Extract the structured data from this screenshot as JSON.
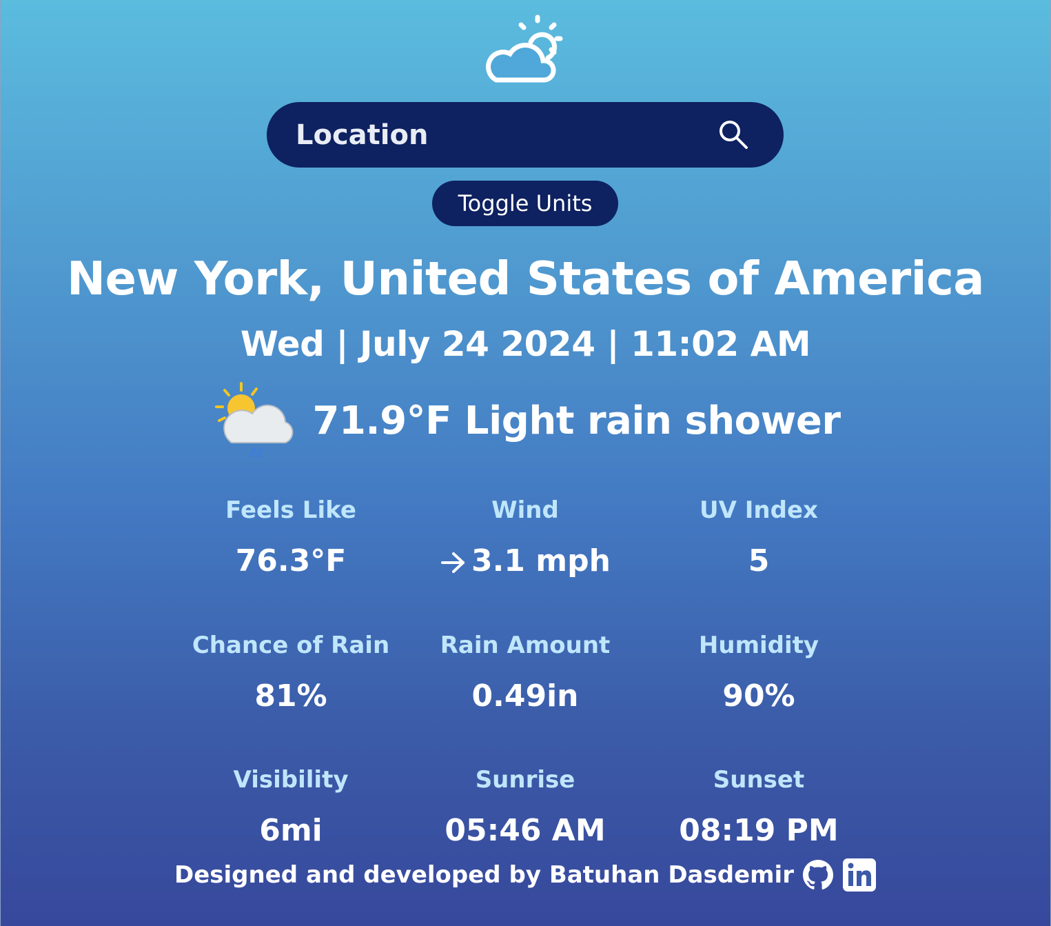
{
  "search": {
    "placeholder": "Location"
  },
  "toggle_label": "Toggle Units",
  "location": "New York, United States of America",
  "datetime": "Wed | July 24 2024 | 11:02 AM",
  "current": {
    "summary": "71.9°F Light rain shower",
    "icon": "sun-cloud-rain-icon"
  },
  "stats": {
    "feels_like": {
      "label": "Feels Like",
      "value": "76.3°F"
    },
    "wind": {
      "label": "Wind",
      "value": "3.1 mph"
    },
    "uv_index": {
      "label": "UV Index",
      "value": "5"
    },
    "chance_of_rain": {
      "label": "Chance of Rain",
      "value": "81%"
    },
    "rain_amount": {
      "label": "Rain Amount",
      "value": "0.49in"
    },
    "humidity": {
      "label": "Humidity",
      "value": "90%"
    },
    "visibility": {
      "label": "Visibility",
      "value": "6mi"
    },
    "sunrise": {
      "label": "Sunrise",
      "value": "05:46 AM"
    },
    "sunset": {
      "label": "Sunset",
      "value": "08:19 PM"
    }
  },
  "footer": {
    "text": "Designed and developed by Batuhan Dasdemir"
  },
  "colors": {
    "accent_dark": "#0e2160",
    "label_blue": "#bfe6fb",
    "gradient_top": "#5bbcde",
    "gradient_bottom": "#37489c"
  }
}
